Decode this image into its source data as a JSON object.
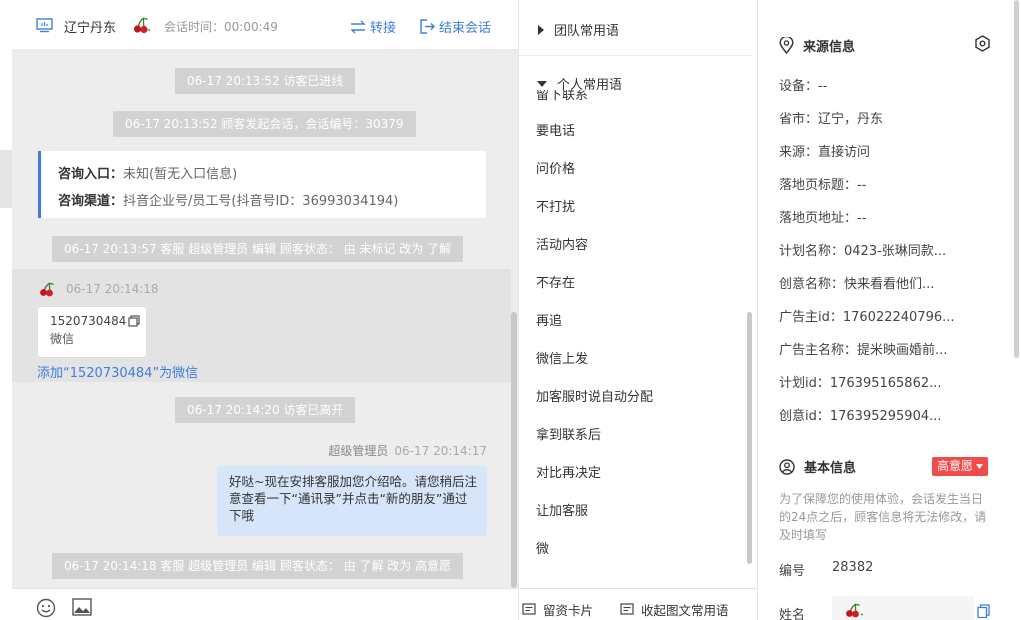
{
  "header": {
    "visitor_name": "辽宁丹东",
    "session_time": "会话时间：00:00:49",
    "transfer_label": "转接",
    "end_label": "结束会话"
  },
  "messages": {
    "sys1": "06-17 20:13:52 访客已进线",
    "sys2": "06-17 20:13:52 顾客发起会话，会话编号：30379",
    "entry_label": "咨询入口：",
    "entry_value": "未知(暂无入口信息)",
    "channel_label": "咨询渠道：",
    "channel_value": "抖音企业号/员工号(抖音号ID：36993034194)",
    "sys3": "06-17 20:13:57 客服 超级管理员 编辑 顾客状态： 由 未标记 改为 了解",
    "visitor_time": "06-17 20:14:18",
    "phone_number": "1520730484",
    "phone_type": "微信",
    "add_wechat": "添加“1520730484”为微信",
    "sys4": "06-17 20:14:20 访客已离开",
    "agent_name": "超级管理员",
    "agent_time": "06-17 20:14:17",
    "agent_text": "好哒~现在安排客服加您介绍哈。请您稍后注意查看一下“通讯录”并点击“新的朋友”通过下哦",
    "sys5": "06-17 20:14:18 客服 超级管理员 编辑 顾客状态： 由 了解 改为 高意愿"
  },
  "phrases": {
    "team_group": "团队常用语",
    "personal_group": "个人常用语",
    "cut_item": "留下联系",
    "items": [
      "要电话",
      "问价格",
      "不打扰",
      "活动内容",
      "不存在",
      "再追",
      "微信上发",
      "加客服时说自动分配",
      "拿到联系后",
      "对比再决定",
      "让加客服",
      "微"
    ],
    "footer_card": "留资卡片",
    "footer_collapse": "收起图文常用语"
  },
  "info": {
    "source_title": "来源信息",
    "rows": [
      "设备：--",
      "省市：辽宁，丹东",
      "来源：直接访问",
      "落地页标题：--",
      "落地页地址：--",
      "计划名称：0423-张琳同款...",
      "创意名称：快来看看他们...",
      "广告主id：176022240796...",
      "广告主名称：提米映画婚前...",
      "计划id：176395165862...",
      "创意id：176395295904..."
    ],
    "basic_title": "基本信息",
    "intent_tag": "高意愿",
    "hint": "为了保障您的使用体验，会话发生当日的24点之后，顾客信息将无法修改，请及时填写",
    "id_label": "编号",
    "id_value": "28382",
    "name_label": "姓名"
  },
  "colors": {
    "accent": "#3e7ee0",
    "bubble": "#d7e5fa",
    "tag": "#f04c4c"
  }
}
